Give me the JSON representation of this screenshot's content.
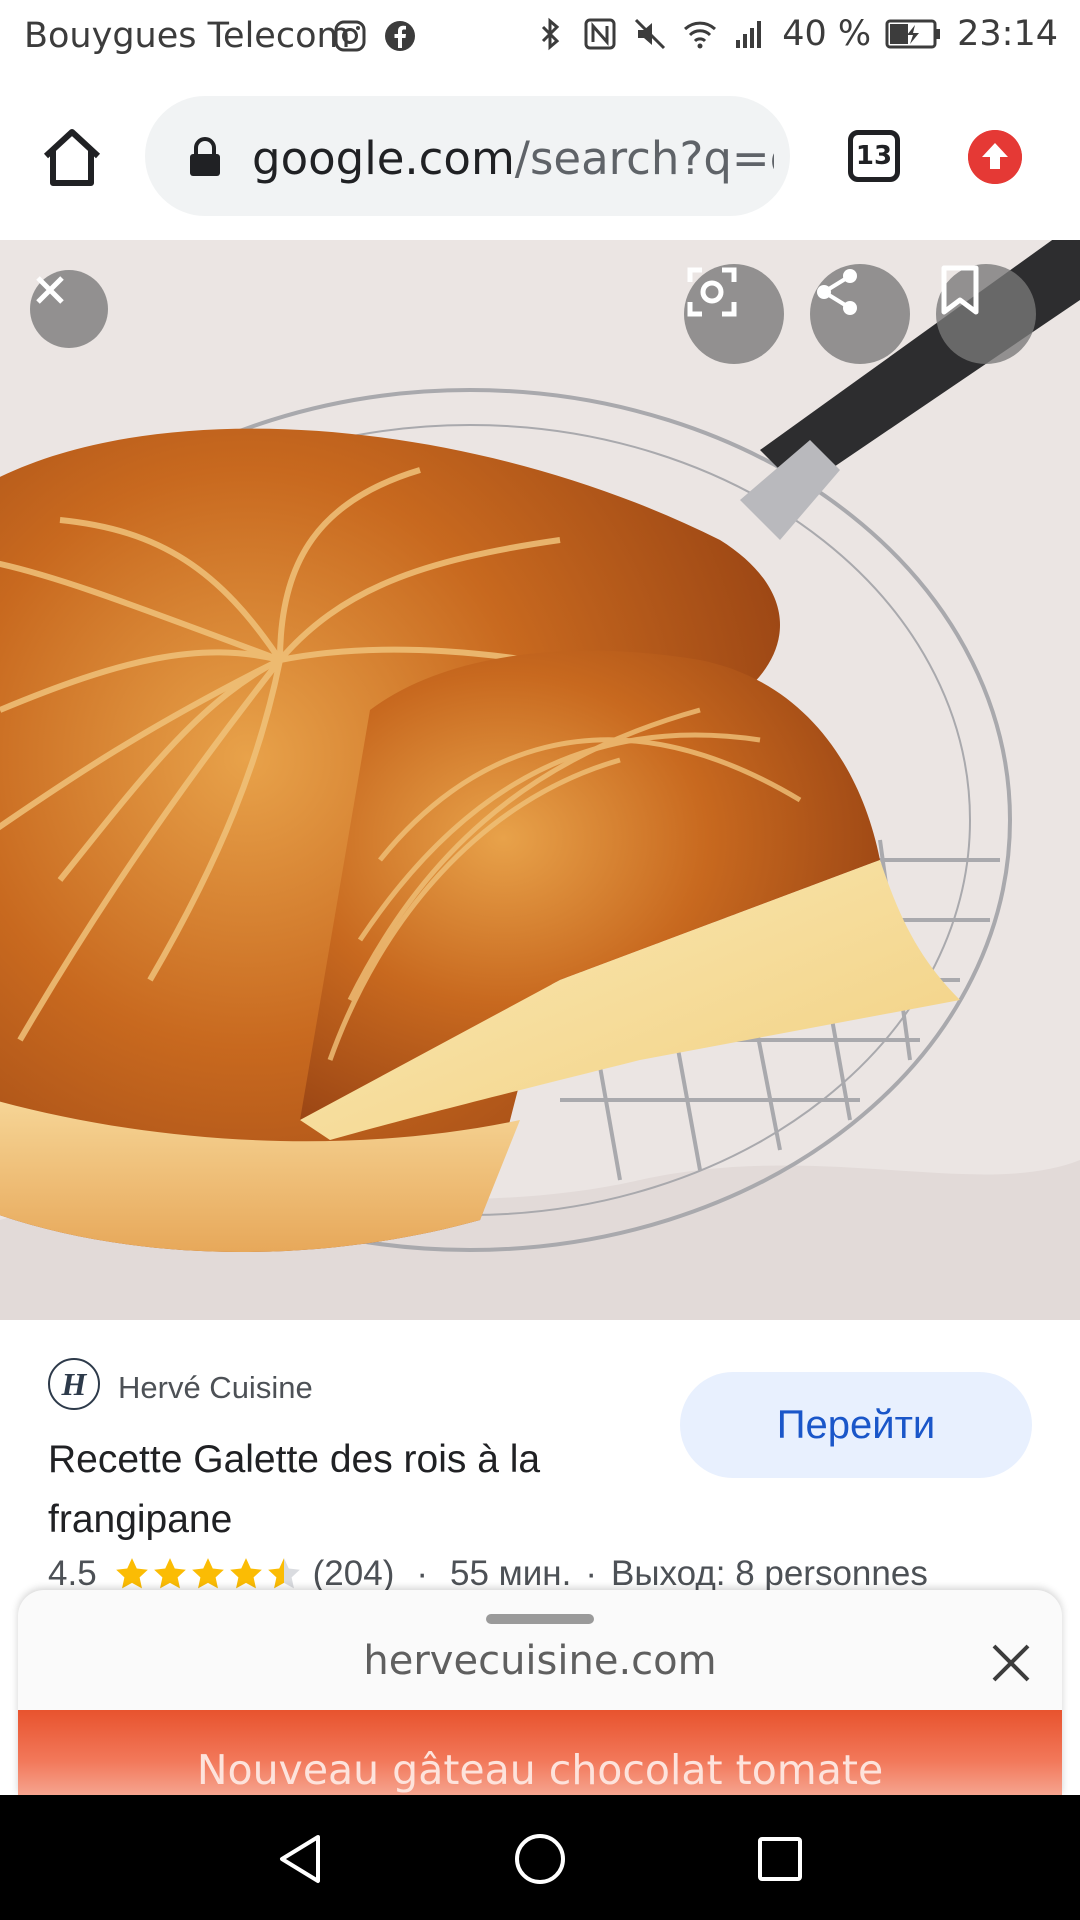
{
  "status_bar": {
    "carrier": "Bouygues Telecom",
    "battery": "40 %",
    "time": "23:14",
    "icons_left": [
      "instagram-icon",
      "facebook-icon"
    ],
    "icons_right": [
      "bluetooth-icon",
      "nfc-icon",
      "mute-icon",
      "wifi-icon",
      "signal-icon",
      "battery-charging-icon"
    ]
  },
  "browser": {
    "url_host": "google.com",
    "url_path": "/search?q=g",
    "tab_count": "13",
    "accent": "#e53935"
  },
  "image_viewer": {
    "buttons": [
      "close-icon",
      "lens-icon",
      "share-icon",
      "bookmark-icon"
    ]
  },
  "result": {
    "source": "Hervé Cuisine",
    "goto_label": "Перейти",
    "title": "Recette Galette des rois à la frangipane",
    "rating": "4.5",
    "rating_value": 4.5,
    "reviews": "(204)",
    "separator": "·",
    "time": "55 мин.",
    "yield": "Выход: 8 personnes"
  },
  "sheet": {
    "domain": "hervecuisine.com",
    "promo": "Nouveau gâteau chocolat tomate",
    "promo_color": "#e8532e"
  }
}
